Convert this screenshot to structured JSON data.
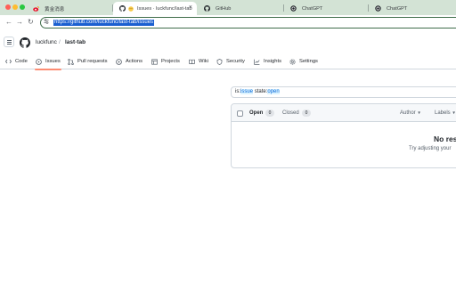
{
  "browser": {
    "tabs": [
      {
        "title": "黄金消息",
        "active": false,
        "favicon": "weibo-icon"
      },
      {
        "title": "Issues · luckfunc/last-tab",
        "active": true,
        "favicon": "github-icon"
      },
      {
        "title": "GitHub",
        "active": false,
        "favicon": "github-icon"
      },
      {
        "title": "ChatGPT",
        "active": false,
        "favicon": "chatgpt-icon"
      },
      {
        "title": "ChatGPT",
        "active": false,
        "favicon": "chatgpt-icon"
      }
    ],
    "url": "https://github.com/luckfunc/last-tab/issues"
  },
  "repo": {
    "owner": "luckfunc",
    "separator": "/",
    "name": "last-tab"
  },
  "nav": [
    {
      "label": "Code",
      "icon": "code-icon"
    },
    {
      "label": "Issues",
      "icon": "issue-opened-icon"
    },
    {
      "label": "Pull requests",
      "icon": "git-pull-request-icon"
    },
    {
      "label": "Actions",
      "icon": "play-icon"
    },
    {
      "label": "Projects",
      "icon": "table-icon"
    },
    {
      "label": "Wiki",
      "icon": "book-icon"
    },
    {
      "label": "Security",
      "icon": "shield-icon"
    },
    {
      "label": "Insights",
      "icon": "graph-icon"
    },
    {
      "label": "Settings",
      "icon": "gear-icon"
    }
  ],
  "issues": {
    "search": {
      "key1": "is:",
      "val1": "issue",
      "key2": "state:",
      "val2": "open"
    },
    "open_label": "Open",
    "open_count": "0",
    "closed_label": "Closed",
    "closed_count": "0",
    "filters": [
      "Author",
      "Labels"
    ],
    "blank_title": "No res",
    "blank_desc": "Try adjusting your"
  },
  "colors": {
    "tabstrip": "#d3e3d5",
    "selected_underline": "#fd8c73",
    "link": "#0969da"
  }
}
